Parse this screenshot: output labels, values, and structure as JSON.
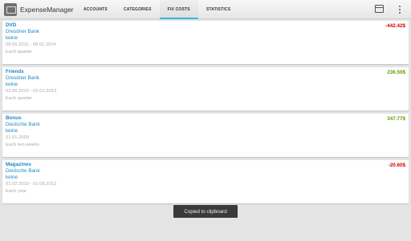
{
  "actionbar": {
    "title": "ExpenseManager",
    "tabs": [
      {
        "label": "ACCOUNTS",
        "active": false
      },
      {
        "label": "CATEGORIES",
        "active": false
      },
      {
        "label": "FIX COSTS",
        "active": true
      },
      {
        "label": "STATISTICS",
        "active": false
      }
    ],
    "icons": [
      "wallet-icon",
      "overflow-menu-icon"
    ]
  },
  "colors": {
    "accent": "#33b5e5",
    "link": "#1e88c8",
    "negative": "#cc0000",
    "positive": "#669900"
  },
  "fixcosts": [
    {
      "name": "DVD",
      "bank": "Dresdner Bank",
      "note": "keine",
      "period": "08.06.2011 - 08.01.2014",
      "frequency": "Each quarter",
      "amount": "-442.42$",
      "sign": "neg"
    },
    {
      "name": "Friends",
      "bank": "Dresdner Bank",
      "note": "keine",
      "period": "02.06.2010 - 02.01.2013",
      "frequency": "Each quarter",
      "amount": "236.50$",
      "sign": "pos"
    },
    {
      "name": "Bonus",
      "bank": "Deutsche Bank",
      "note": "keine",
      "period": "01.01.2009",
      "frequency": "Each two weeks",
      "amount": "347.77$",
      "sign": "pos"
    },
    {
      "name": "Magazines",
      "bank": "Deutsche Bank",
      "note": "keine",
      "period": "01.02.2010 - 01.09.2012",
      "frequency": "Each year",
      "amount": "-20.60$",
      "sign": "neg"
    }
  ],
  "toast": {
    "text": "Copied to clipboard"
  }
}
